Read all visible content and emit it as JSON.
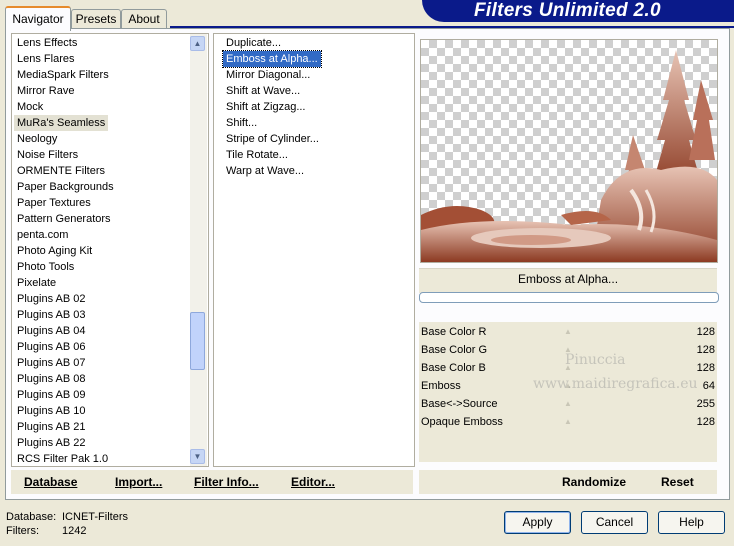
{
  "tabs": [
    {
      "label": "Navigator",
      "active": true
    },
    {
      "label": "Presets",
      "active": false
    },
    {
      "label": "About",
      "active": false
    }
  ],
  "banner": {
    "title": "Filters Unlimited 2.0"
  },
  "categories": [
    "Lens Effects",
    "Lens Flares",
    "MediaSpark Filters",
    "Mirror Rave",
    "Mock",
    "MuRa's Seamless",
    "Neology",
    "Noise Filters",
    "ORMENTE Filters",
    "Paper Backgrounds",
    "Paper Textures",
    "Pattern Generators",
    "penta.com",
    "Photo Aging Kit",
    "Photo Tools",
    "Pixelate",
    "Plugins AB 02",
    "Plugins AB 03",
    "Plugins AB 04",
    "Plugins AB 06",
    "Plugins AB 07",
    "Plugins AB 08",
    "Plugins AB 09",
    "Plugins AB 10",
    "Plugins AB 21",
    "Plugins AB 22",
    "RCS Filter Pak 1.0"
  ],
  "selected_category": "MuRa's Seamless",
  "filters": [
    "Duplicate...",
    "Emboss at Alpha...",
    "Mirror Diagonal...",
    "Shift at Wave...",
    "Shift at Zigzag...",
    "Shift...",
    "Stripe of Cylinder...",
    "Tile Rotate...",
    "Warp at Wave..."
  ],
  "selected_filter": "Emboss at Alpha...",
  "preview": {
    "filter_name": "Emboss at Alpha...",
    "tint_color": "#a85a3c"
  },
  "params": [
    {
      "label": "Base Color R",
      "value": "128"
    },
    {
      "label": "Base Color G",
      "value": "128"
    },
    {
      "label": "Base Color B",
      "value": "128"
    },
    {
      "label": "Emboss",
      "value": "64"
    },
    {
      "label": "Base<->Source",
      "value": "255"
    },
    {
      "label": "Opaque Emboss",
      "value": "128"
    }
  ],
  "watermark": {
    "line1": "Pinuccia",
    "line2": "www.maidiregrafica.eu"
  },
  "bottom_links": {
    "database": "Database",
    "import": "Import...",
    "filter_info": "Filter Info...",
    "editor": "Editor...",
    "randomize": "Randomize",
    "reset": "Reset"
  },
  "status": {
    "database_label": "Database:",
    "database_value": "ICNET-Filters",
    "filters_label": "Filters:",
    "filters_value": "1242"
  },
  "buttons": {
    "apply": "Apply",
    "cancel": "Cancel",
    "help": "Help"
  }
}
